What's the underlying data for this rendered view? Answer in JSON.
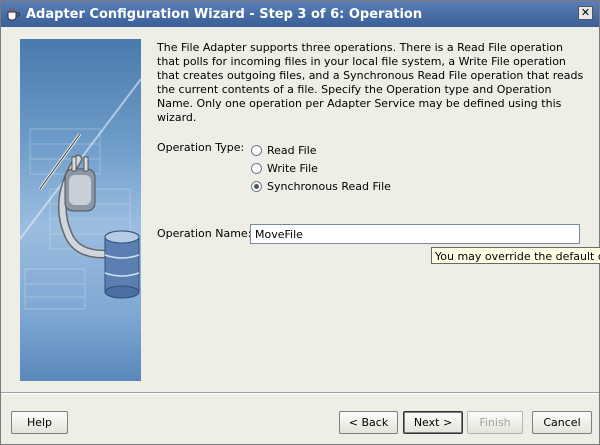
{
  "window": {
    "title": "Adapter Configuration Wizard - Step 3 of 6: Operation",
    "close_glyph": "✕"
  },
  "description": "The File Adapter supports three operations.  There is a Read File operation that polls for incoming files in your local file system, a Write File operation that creates outgoing files, and a Synchronous Read File operation that reads the current contents of a file. Specify the Operation type and Operation Name.  Only one operation per Adapter Service may be defined using this wizard.",
  "operation_type": {
    "label": "Operation Type:",
    "options": [
      {
        "label": "Read File",
        "selected": false
      },
      {
        "label": "Write File",
        "selected": false
      },
      {
        "label": "Synchronous Read File",
        "selected": true
      }
    ]
  },
  "operation_name": {
    "label": "Operation Name:",
    "value": "MoveFile"
  },
  "tooltip": "You may override the default oper",
  "buttons": {
    "help": "Help",
    "back": "< Back",
    "next": "Next >",
    "finish": "Finish",
    "cancel": "Cancel"
  },
  "icons": {
    "app": "coffee-cup-icon",
    "art": "plug-database-icon"
  }
}
